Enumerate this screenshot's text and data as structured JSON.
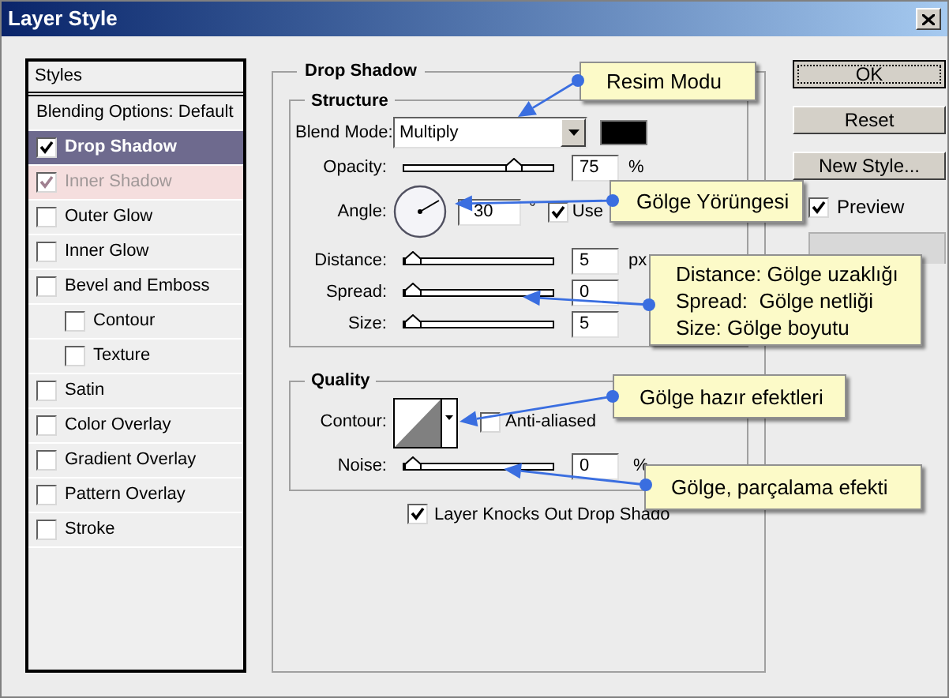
{
  "window": {
    "title": "Layer Style"
  },
  "styles_panel": {
    "header": "Styles",
    "items": [
      {
        "label": "Blending Options: Default",
        "kind": "plain",
        "selected": false
      },
      {
        "label": "Drop Shadow",
        "kind": "check",
        "checked": true,
        "selected": true,
        "hovered": false
      },
      {
        "label": "Inner Shadow",
        "kind": "check",
        "checked": true,
        "selected": false,
        "hovered": true
      },
      {
        "label": "Outer Glow",
        "kind": "check",
        "checked": false,
        "selected": false,
        "hovered": false
      },
      {
        "label": "Inner Glow",
        "kind": "check",
        "checked": false,
        "selected": false,
        "hovered": false
      },
      {
        "label": "Bevel and Emboss",
        "kind": "check",
        "checked": false,
        "selected": false,
        "hovered": false,
        "children": [
          {
            "label": "Contour",
            "kind": "check",
            "checked": false,
            "selected": false,
            "hovered": false
          },
          {
            "label": "Texture",
            "kind": "check",
            "checked": false,
            "selected": false,
            "hovered": false
          }
        ]
      },
      {
        "label": "Satin",
        "kind": "check",
        "checked": false,
        "selected": false,
        "hovered": false
      },
      {
        "label": "Color Overlay",
        "kind": "check",
        "checked": false,
        "selected": false,
        "hovered": false
      },
      {
        "label": "Gradient Overlay",
        "kind": "check",
        "checked": false,
        "selected": false,
        "hovered": false
      },
      {
        "label": "Pattern Overlay",
        "kind": "check",
        "checked": false,
        "selected": false,
        "hovered": false
      },
      {
        "label": "Stroke",
        "kind": "check",
        "checked": false,
        "selected": false,
        "hovered": false
      }
    ]
  },
  "drop_shadow": {
    "title": "Drop Shadow",
    "structure": {
      "title": "Structure",
      "rows": [
        {
          "kind": "select",
          "label": "Blend Mode:",
          "value": "Multiply"
        },
        {
          "kind": "slider",
          "label": "Opacity:",
          "level": 0.75,
          "value": "75",
          "unit": "%"
        },
        {
          "kind": "angle",
          "label": "Angle:",
          "value": "30",
          "unit": "°",
          "global_light": {
            "label": "Use",
            "checked": true
          }
        },
        {
          "kind": "slider",
          "label": "Distance:",
          "level": 0,
          "value": "5",
          "unit": "px"
        },
        {
          "kind": "slider",
          "label": "Spread:",
          "level": 0,
          "value": "0"
        },
        {
          "kind": "slider",
          "label": "Size:",
          "level": 0,
          "value": "5"
        }
      ]
    },
    "quality": {
      "title": "Quality",
      "contour": {
        "label": "Contour:",
        "anti_aliased": {
          "label": "Anti-aliased",
          "checked": false
        }
      },
      "noise": {
        "label": "Noise:",
        "level": 0,
        "value": "0",
        "unit": "%"
      }
    },
    "knockout": {
      "label": "Layer Knocks Out Drop Shado",
      "checked": true
    }
  },
  "buttons": [
    {
      "label": "OK",
      "kind": "default"
    },
    {
      "label": "Reset",
      "kind": "normal"
    },
    {
      "label": "New Style...",
      "kind": "normal"
    }
  ],
  "preview": {
    "label": "Preview",
    "checked": true
  },
  "callouts": [
    {
      "lines": [
        "Resim Modu"
      ]
    },
    {
      "lines": [
        "Gölge Yörüngesi"
      ]
    },
    {
      "lines": [
        "Distance: Gölge uzaklığı",
        "Spread:  Gölge netliği",
        "Size: Gölge boyutu"
      ]
    },
    {
      "lines": [
        "Gölge hazır efektleri"
      ]
    },
    {
      "lines": [
        "Gölge, parçalama efekti"
      ]
    }
  ]
}
